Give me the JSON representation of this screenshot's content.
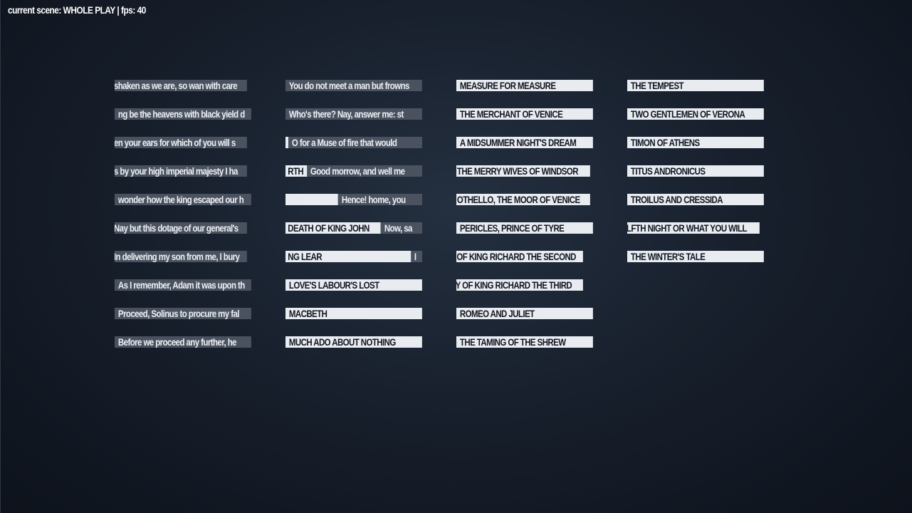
{
  "status": {
    "label": "current scene:",
    "scene": "WHOLE PLAY",
    "separator": "|",
    "fps_label": "fps:",
    "fps": "40"
  },
  "columns": [
    {
      "tiles": [
        {
          "segments": [
            {
              "text": "shaken as we are, so wan with care",
              "style": "dark"
            }
          ]
        },
        {
          "segments": [
            {
              "text": "ng be the heavens with black yield d",
              "style": "dark"
            }
          ]
        },
        {
          "segments": [
            {
              "text": "en your ears for which of you will s",
              "style": "dark"
            }
          ]
        },
        {
          "segments": [
            {
              "text": "s by your high imperial majesty  I ha",
              "style": "dark"
            }
          ]
        },
        {
          "segments": [
            {
              "text": "wonder how the king escaped our h",
              "style": "dark"
            }
          ]
        },
        {
          "segments": [
            {
              "text": "Nay but this dotage of our general's",
              "style": "dark"
            }
          ]
        },
        {
          "segments": [
            {
              "text": "In delivering my son from me, I bury",
              "style": "dark"
            }
          ]
        },
        {
          "segments": [
            {
              "text": "As I remember, Adam it was upon th",
              "style": "dark"
            }
          ]
        },
        {
          "segments": [
            {
              "text": "Proceed, Solinus to procure my fal",
              "style": "dark"
            }
          ]
        },
        {
          "segments": [
            {
              "text": "Before we proceed any further, he",
              "style": "dark"
            }
          ]
        }
      ]
    },
    {
      "tiles": [
        {
          "segments": [
            {
              "text": "You do not meet a man but frowns",
              "style": "dark"
            }
          ]
        },
        {
          "segments": [
            {
              "text": "Who's there?  Nay, answer me: st",
              "style": "dark"
            }
          ]
        },
        {
          "segments": [
            {
              "text": "",
              "style": "light"
            },
            {
              "text": "O for a Muse of fire that would",
              "style": "dark"
            }
          ]
        },
        {
          "segments": [
            {
              "text": "RTH",
              "style": "light"
            },
            {
              "text": "Good morrow, and well me",
              "style": "dark"
            }
          ]
        },
        {
          "segments": [
            {
              "text": "",
              "style": "light"
            },
            {
              "text": "Hence! home, you",
              "style": "dark"
            }
          ]
        },
        {
          "segments": [
            {
              "text": "DEATH OF KING JOHN",
              "style": "light"
            },
            {
              "text": "Now, sa",
              "style": "dark"
            }
          ]
        },
        {
          "segments": [
            {
              "text": "NG LEAR",
              "style": "light"
            },
            {
              "text": "I",
              "style": "dark"
            }
          ]
        },
        {
          "segments": [
            {
              "text": "LOVE'S LABOUR'S LOST",
              "style": "light"
            }
          ]
        },
        {
          "segments": [
            {
              "text": "MACBETH",
              "style": "light"
            }
          ]
        },
        {
          "segments": [
            {
              "text": "MUCH ADO ABOUT NOTHING",
              "style": "light"
            }
          ]
        }
      ]
    },
    {
      "tiles": [
        {
          "segments": [
            {
              "text": "MEASURE FOR MEASURE",
              "style": "light"
            }
          ]
        },
        {
          "segments": [
            {
              "text": "THE MERCHANT OF VENICE",
              "style": "light"
            }
          ]
        },
        {
          "segments": [
            {
              "text": "A MIDSUMMER NIGHT'S DREAM",
              "style": "light"
            }
          ]
        },
        {
          "segments": [
            {
              "text": "THE MERRY WIVES OF WINDSOR",
              "style": "light"
            }
          ]
        },
        {
          "segments": [
            {
              "text": "OTHELLO, THE MOOR OF VENICE",
              "style": "light"
            }
          ]
        },
        {
          "segments": [
            {
              "text": "PERICLES, PRINCE OF TYRE",
              "style": "light"
            }
          ]
        },
        {
          "segments": [
            {
              "text": "Y OF KING RICHARD THE SECOND",
              "style": "light"
            }
          ]
        },
        {
          "segments": [
            {
              "text": "DY OF KING RICHARD THE THIRD",
              "style": "light"
            }
          ]
        },
        {
          "segments": [
            {
              "text": "ROMEO AND JULIET",
              "style": "light"
            }
          ]
        },
        {
          "segments": [
            {
              "text": "THE TAMING OF THE SHREW",
              "style": "light"
            }
          ]
        }
      ]
    },
    {
      "tiles": [
        {
          "segments": [
            {
              "text": "THE TEMPEST",
              "style": "light"
            }
          ]
        },
        {
          "segments": [
            {
              "text": "TWO GENTLEMEN OF VERONA",
              "style": "light"
            }
          ]
        },
        {
          "segments": [
            {
              "text": "TIMON OF ATHENS",
              "style": "light"
            }
          ]
        },
        {
          "segments": [
            {
              "text": "TITUS ANDRONICUS",
              "style": "light"
            }
          ]
        },
        {
          "segments": [
            {
              "text": "TROILUS AND CRESSIDA",
              "style": "light"
            }
          ]
        },
        {
          "segments": [
            {
              "text": "LFTH NIGHT OR WHAT YOU WILL",
              "style": "light"
            }
          ]
        },
        {
          "segments": [
            {
              "text": "THE WINTER'S TALE",
              "style": "light"
            }
          ]
        }
      ]
    }
  ]
}
